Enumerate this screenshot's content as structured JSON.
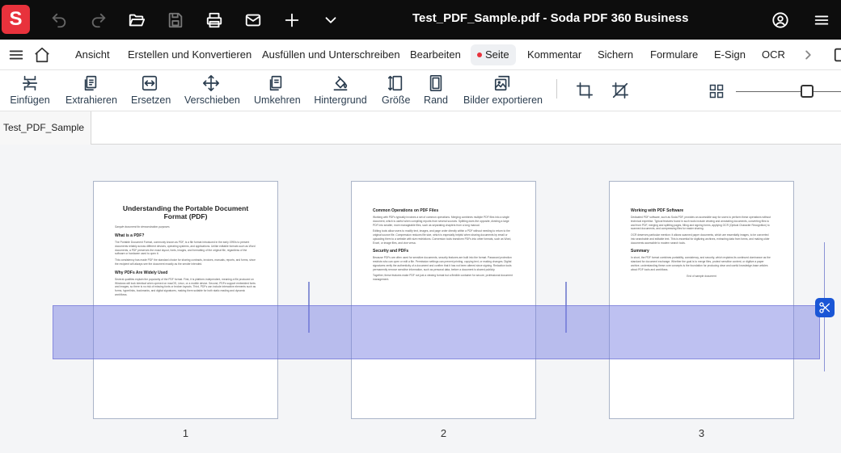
{
  "app": {
    "logo_letter": "S",
    "doc_title": "Test_PDF_Sample.pdf  -  Soda PDF 360 Business"
  },
  "titlebar_icons": [
    "undo-icon",
    "redo-icon",
    "open-folder-icon",
    "save-icon",
    "print-icon",
    "mail-icon",
    "plus-icon",
    "chevron-down-icon",
    "user-icon",
    "hamburger-menu-icon"
  ],
  "menu": {
    "items": [
      "Ansicht",
      "Erstellen und Konvertieren",
      "Ausfüllen und Unterschreiben",
      "Bearbeiten",
      "Seite",
      "Kommentar",
      "Sichern",
      "Formulare",
      "E-Sign",
      "OCR"
    ],
    "active": "Seite"
  },
  "toolbar": {
    "tools": [
      "Einfügen",
      "Extrahieren",
      "Ersetzen",
      "Verschieben",
      "Umkehren",
      "Hintergrund",
      "Größe",
      "Rand",
      "Bilder exportieren"
    ]
  },
  "tabs": [
    "Test_PDF_Sample"
  ],
  "pages": [
    {
      "number": "1",
      "title": "Understanding the Portable Document Format (PDF)",
      "subtitle": "Sample document for demonstration purposes",
      "sections": [
        {
          "heading": "What is a PDF?",
          "text": "The Portable Document Format, commonly known as PDF, is a file format introduced in the early 1990s to present documents reliably across different devices, operating systems, and applications. Unlike editable formats such as Word documents, a PDF preserves the exact layout, fonts, images, and formatting of the original file, regardless of the software or hardware used to open it."
        },
        {
          "heading": "",
          "text": "This consistency has made PDF the standard choice for sharing contracts, invoices, manuals, reports, and forms, since the recipient will always see the document exactly as the sender intended."
        },
        {
          "heading": "Why PDFs Are Widely Used",
          "text": "Several qualities explain the popularity of the PDF format. First, it is platform-independent, meaning a file produced on Windows will look identical when opened on macOS, Linux, or a mobile device. Second, PDFs support embedded fonts and images, so there is no risk of missing fonts or broken layouts. Third, PDFs can include interactive elements such as forms, hyperlinks, bookmarks, and digital signatures, making them suitable for both static reading and dynamic workflows."
        }
      ]
    },
    {
      "number": "2",
      "title": "",
      "subtitle": "",
      "sections": [
        {
          "heading": "Common Operations on PDF Files",
          "text": "Working with PDFs typically involves a set of common operations. Merging combines multiple PDF files into a single document, which is useful when compiling reports from several sources. Splitting does the opposite, dividing a large PDF into smaller, more manageable files, such as separating chapters from a long manual."
        },
        {
          "heading": "",
          "text": "Editing tools allow users to modify text, images, and page order directly within a PDF without needing to return to the original source file. Compression reduces file size, which is especially helpful when sharing documents by email or uploading them to a website with size restrictions. Conversion tools transform PDFs into other formats, such as Word, Excel, or image files, and vice versa."
        },
        {
          "heading": "Security and PDFs",
          "text": "Because PDFs are often used for sensitive documents, security features are built into the format. Password protection restricts who can open or edit a file. Permission settings can prevent printing, copying text, or making changes. Digital signatures verify the authenticity of a document and confirm that it has not been altered since signing. Redaction tools permanently remove sensitive information, such as personal data, before a document is shared publicly."
        },
        {
          "heading": "",
          "text": "Together, these features make PDF not just a viewing format but a flexible container for secure, professional document management."
        }
      ]
    },
    {
      "number": "3",
      "title": "",
      "subtitle": "",
      "sections": [
        {
          "heading": "Working with PDF Software",
          "text": "Dedicated PDF software, such as Soda PDF, provides an accessible way for users to perform these operations without technical expertise. Typical features found in such tools include viewing and annotating documents, converting files to and from PDF, merging and splitting pages, filling and signing forms, applying OCR (Optical Character Recognition) to scanned documents, and compressing files for easier sharing."
        },
        {
          "heading": "",
          "text": "OCR deserves particular mention: it allows scanned paper documents, which are essentially images, to be converted into searchable and editable text. This is essential for digitizing archives, extracting data from forms, and making older documents accessible to modern search tools."
        },
        {
          "heading": "Summary",
          "text": "In short, the PDF format combines portability, consistency, and security, which explains its continued dominance as the standard for document exchange. Whether the goal is to merge files, protect sensitive content, or digitize a paper archive, understanding these core concepts is the foundation for producing clear and useful knowledge-base articles about PDF tools and workflows."
        },
        {
          "heading": "",
          "text": "End of sample document"
        }
      ]
    }
  ]
}
